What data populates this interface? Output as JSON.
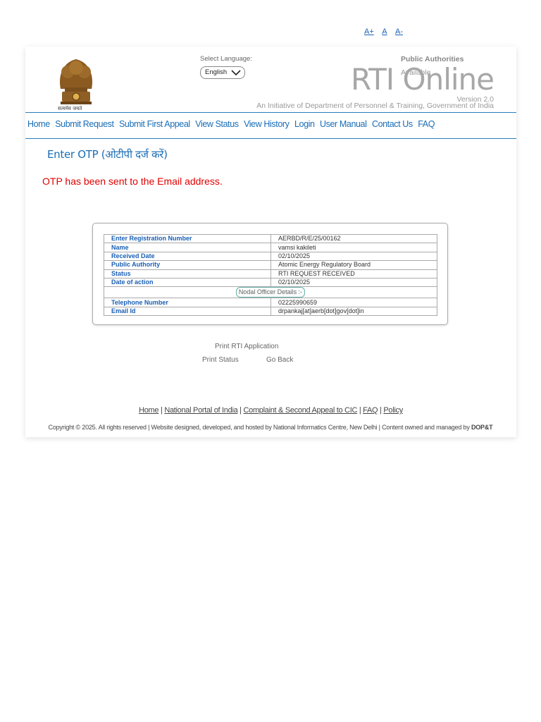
{
  "font_controls": [
    "A+",
    "A",
    "A-"
  ],
  "header": {
    "emblem_caption": "सत्यमेव जयते",
    "language_label": "Select Language:",
    "language_selected": "English",
    "public_authorities_label": "Public Authorities",
    "public_authorities_sub": "Available",
    "brand": "RTI Online",
    "version": "Version 2.0",
    "tagline": "An Initiative of Department of Personnel & Training, Government of India"
  },
  "nav": [
    "Home",
    "Submit Request",
    "Submit First Appeal",
    "View Status",
    "View History",
    "Login",
    "User Manual",
    "Contact Us",
    "FAQ"
  ],
  "otp": {
    "title": "Enter OTP (ओटीपी दर्ज करें)",
    "message": "OTP has been sent to the Email address."
  },
  "details": {
    "rows": [
      {
        "key": "Enter Registration Number",
        "value": "AERBD/R/E/25/00162"
      },
      {
        "key": "Name",
        "value": "vamsi kakileti"
      },
      {
        "key": "Received Date",
        "value": "02/10/2025"
      },
      {
        "key": "Public Authority",
        "value": "Atomic Energy Regulatory Board"
      },
      {
        "key": "Status",
        "value": "RTI REQUEST RECEIVED"
      },
      {
        "key": "Date of action",
        "value": "02/10/2025"
      }
    ],
    "nodal_header": "Nodal Officer Details :-",
    "nodal_rows": [
      {
        "key": "Telephone Number",
        "value": "02225990659"
      },
      {
        "key": "Email Id",
        "value": "drpankaj[at]aerb[dot]gov[dot]in"
      }
    ]
  },
  "actions": {
    "print_application": "Print RTI Application",
    "print_status": "Print Status",
    "go_back": "Go Back"
  },
  "footer": {
    "links": [
      "Home",
      "National Portal of India",
      "Complaint & Second Appeal to CIC",
      "FAQ",
      "Policy"
    ],
    "copyright_main": "Copyright © 2025. All rights reserved | Website designed, developed, and hosted by National Informatics Centre, New Delhi | Content owned and managed",
    "copyright_by": "by",
    "copyright_owner": "DOP&T"
  },
  "colors": {
    "link": "#1a6db5",
    "error": "#e00000",
    "divider": "#2a7fbd"
  }
}
